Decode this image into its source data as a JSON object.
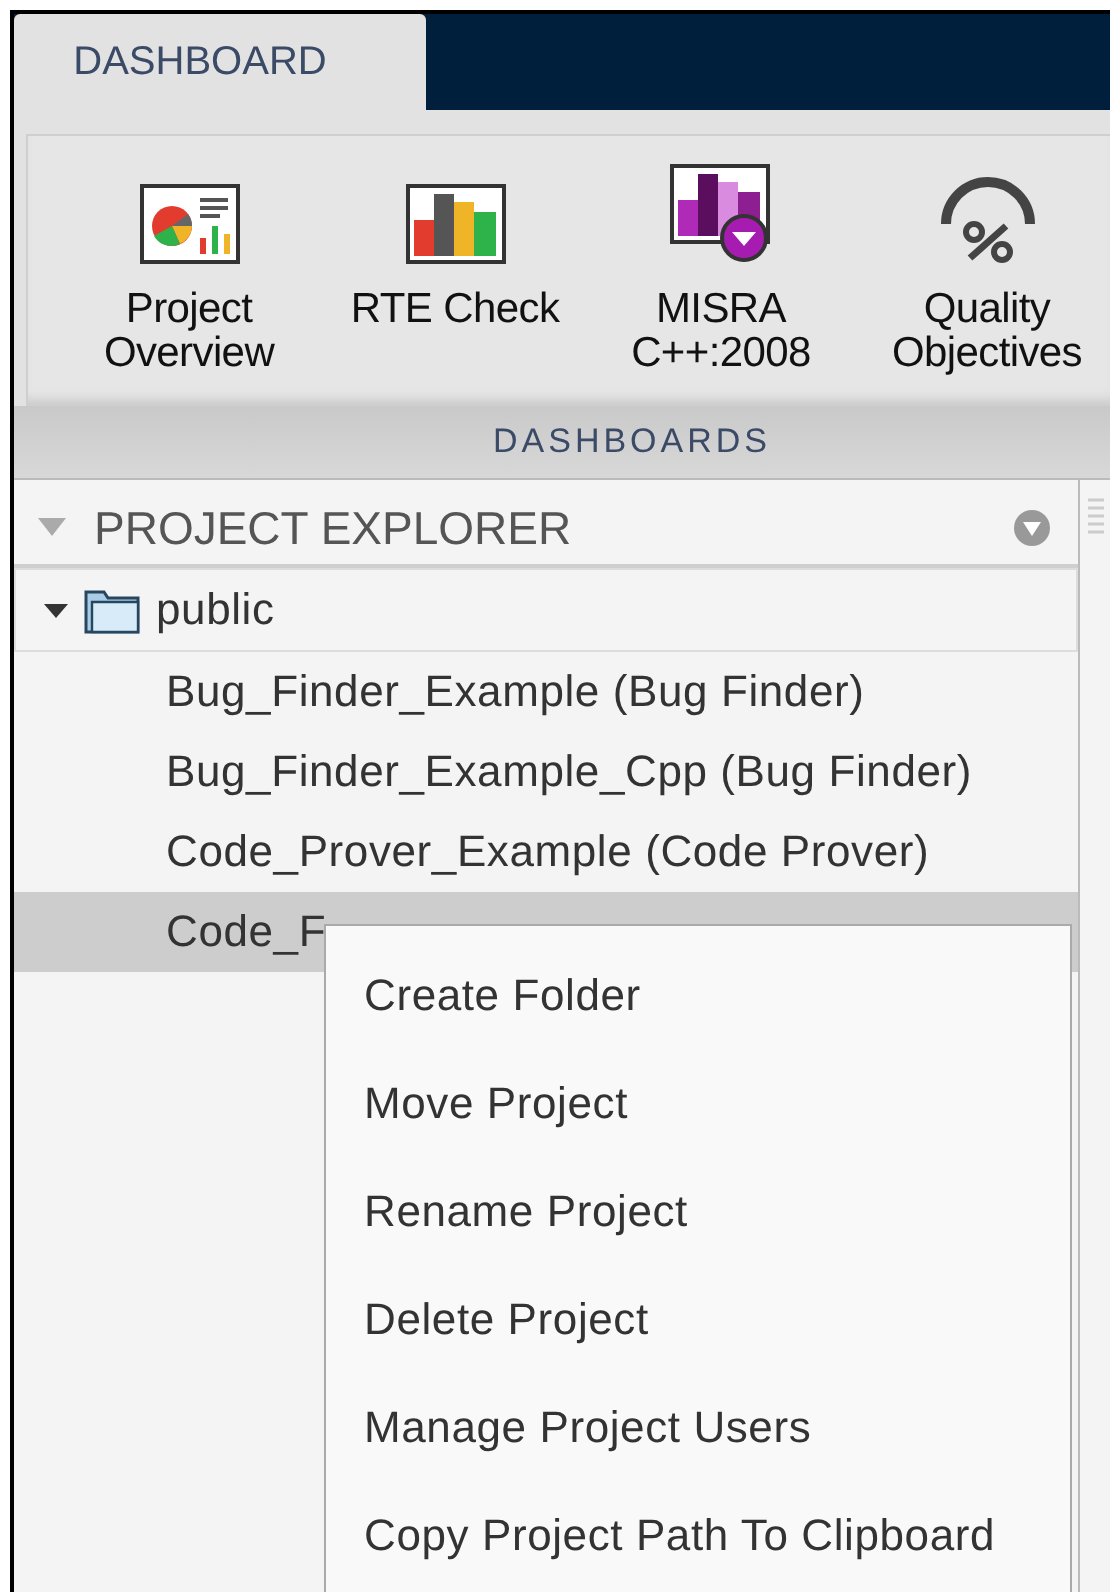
{
  "tabs": [
    {
      "label": "DASHBOARD",
      "selected": true
    }
  ],
  "toolbar": {
    "buttons": [
      {
        "kind": "overview",
        "label_lines": [
          "Project",
          "Overview"
        ]
      },
      {
        "kind": "rte",
        "label_lines": [
          "RTE Check"
        ]
      },
      {
        "kind": "misra",
        "label_lines": [
          "MISRA",
          "C++:2008"
        ]
      },
      {
        "kind": "quality",
        "label_lines": [
          "Quality",
          "Objectives"
        ]
      }
    ],
    "section_label": "DASHBOARDS"
  },
  "explorer": {
    "title": "PROJECT EXPLORER",
    "tree": [
      {
        "label": "public",
        "expanded": true,
        "children": [
          {
            "label": "Bug_Finder_Example (Bug Finder)",
            "selected": false
          },
          {
            "label": "Bug_Finder_Example_Cpp (Bug Finder)",
            "selected": false
          },
          {
            "label": "Code_Prover_Example (Code Prover)",
            "selected": false
          },
          {
            "label": "Code_F",
            "selected": true
          }
        ]
      }
    ]
  },
  "context_menu": {
    "items": [
      "Create Folder",
      "Move Project",
      "Rename Project",
      "Delete Project",
      "Manage Project Users",
      "Copy Project Path To Clipboard"
    ]
  }
}
